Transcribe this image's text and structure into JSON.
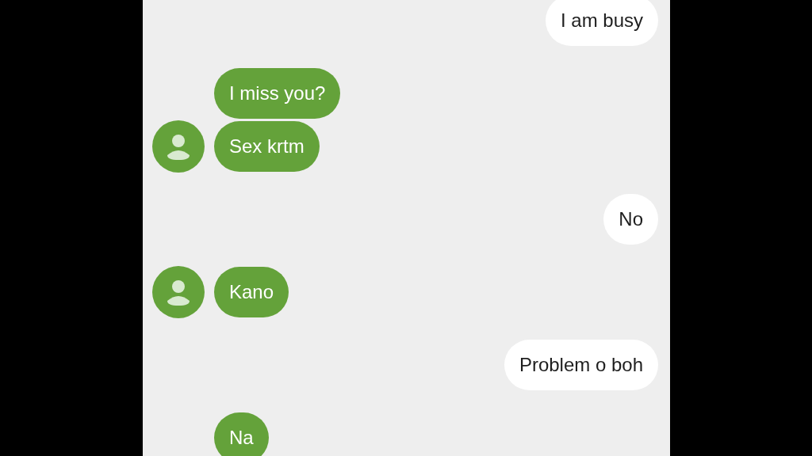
{
  "messages": [
    {
      "kind": "outgoing",
      "text": "I am busy"
    },
    {
      "kind": "incoming",
      "text": "I miss you?",
      "avatar": false
    },
    {
      "kind": "incoming",
      "text": "Sex krtm",
      "avatar": true
    },
    {
      "kind": "outgoing",
      "text": "No"
    },
    {
      "kind": "incoming",
      "text": "Kano",
      "avatar": true
    },
    {
      "kind": "outgoing",
      "text": "Problem o boh"
    },
    {
      "kind": "incoming",
      "text": "Na",
      "avatar": false
    }
  ]
}
